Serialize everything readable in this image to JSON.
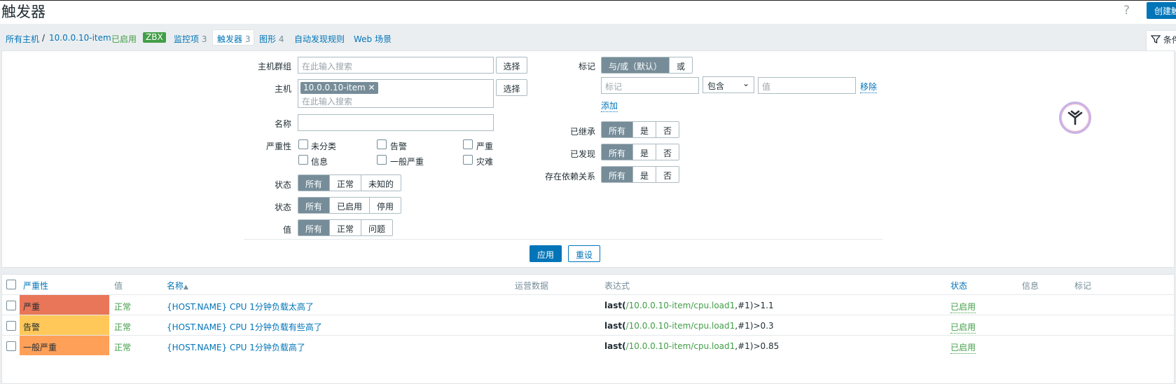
{
  "header": {
    "title": "触发器",
    "help_icon": "?",
    "create_button": "创建触发器"
  },
  "breadcrumb": {
    "all_hosts": "所有主机",
    "separator": "/",
    "host": "10.0.0.10-item",
    "enabled": "已启用",
    "zbx": "ZBX",
    "items_label": "监控项",
    "items_count": "3",
    "triggers_label": "触发器",
    "triggers_count": "3",
    "graphs_label": "图形",
    "graphs_count": "4",
    "discovery_label": "自动发现规则",
    "web_label": "Web 场景"
  },
  "filter_tab": {
    "label": "条件"
  },
  "filter": {
    "host_group_label": "主机群组",
    "host_group_placeholder": "在此输入搜索",
    "select_button": "选择",
    "host_label": "主机",
    "host_chip": "10.0.0.10-item",
    "host_placeholder": "在此输入搜索",
    "name_label": "名称",
    "name_value": "",
    "severity_label": "严重性",
    "severities": [
      "未分类",
      "告警",
      "严重",
      "信息",
      "一般严重",
      "灾难"
    ],
    "state_label": "状态",
    "state_options": [
      "所有",
      "正常",
      "未知的"
    ],
    "status_label": "状态",
    "status_options": [
      "所有",
      "已启用",
      "停用"
    ],
    "value_label": "值",
    "value_options": [
      "所有",
      "正常",
      "问题"
    ],
    "tags_label": "标记",
    "tags_options": [
      "与/或（默认）",
      "或"
    ],
    "tag_placeholder": "标记",
    "tag_operator": "包含",
    "tag_value_placeholder": "值",
    "remove_link": "移除",
    "add_link": "添加",
    "inherited_label": "已继承",
    "discovered_label": "已发现",
    "dependencies_label": "存在依赖关系",
    "yes_no_options": [
      "所有",
      "是",
      "否"
    ],
    "apply_button": "应用",
    "reset_button": "重设"
  },
  "table": {
    "headers": {
      "severity": "严重性",
      "value": "值",
      "name": "名称",
      "sort_arrow": "▲",
      "operational_data": "运营数据",
      "expression": "表达式",
      "status": "状态",
      "info": "信息",
      "tags": "标记"
    },
    "rows": [
      {
        "severity": "严重",
        "severity_color": "#e97659",
        "value": "正常",
        "name": "{HOST.NAME} CPU 1分钟负载太高了",
        "expr_func": "last",
        "expr_open": "(",
        "expr_key": "/10.0.0.10-item/cpu.load1",
        "expr_rest": ",#1)>1.1",
        "status": "已启用"
      },
      {
        "severity": "告警",
        "severity_color": "#ffc859",
        "value": "正常",
        "name": "{HOST.NAME} CPU 1分钟负载有些高了",
        "expr_func": "last",
        "expr_open": "(",
        "expr_key": "/10.0.0.10-item/cpu.load1",
        "expr_rest": ",#1)>0.3",
        "status": "已启用"
      },
      {
        "severity": "一般严重",
        "severity_color": "#ffa059",
        "value": "正常",
        "name": "{HOST.NAME} CPU 1分钟负载高了",
        "expr_func": "last",
        "expr_open": "(",
        "expr_key": "/10.0.0.10-item/cpu.load1",
        "expr_rest": ",#1)>0.85",
        "status": "已启用"
      }
    ]
  }
}
